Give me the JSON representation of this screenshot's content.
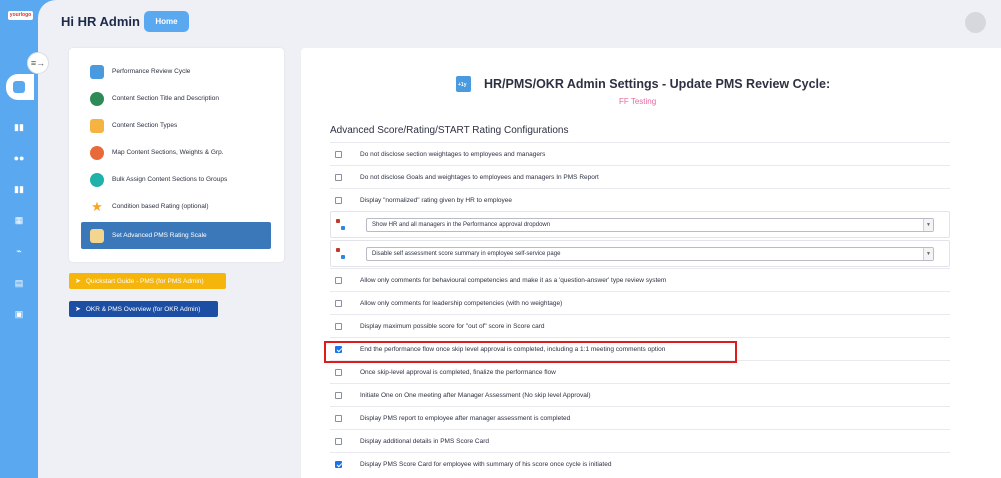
{
  "app": {
    "logo_text": "yourlogo",
    "greeting": "Hi HR Admin",
    "home_button": "Home"
  },
  "sidebar": {
    "icons": [
      "analytics-icon",
      "book-icon",
      "users-icon",
      "book-icon",
      "report-icon",
      "handshake-icon",
      "document-icon",
      "calendar-icon"
    ]
  },
  "left_menu": {
    "items": [
      {
        "label": "Performance Review Cycle",
        "icon": "calendar-icon",
        "color": "#4a9ae0"
      },
      {
        "label": "Content Section Title and Description",
        "icon": "sections-icon",
        "color": "#2e8b57"
      },
      {
        "label": "Content Section Types",
        "icon": "badge-icon",
        "color": "#f5b342"
      },
      {
        "label": "Map Content Sections, Weights & Grp.",
        "icon": "user-map-icon",
        "color": "#e86a3a"
      },
      {
        "label": "Bulk Assign Content Sections to Groups",
        "icon": "group-icon",
        "color": "#20b2aa"
      },
      {
        "label": "Condition based Rating (optional)",
        "icon": "star-icon",
        "color": "#f5a623"
      },
      {
        "label": "Set Advanced PMS Rating Scale",
        "icon": "rating-scale-icon",
        "color": "#ffffff",
        "active": true
      }
    ]
  },
  "guides": {
    "quickstart": {
      "label": "Quickstart Guide - PMS (for PMS Admin)",
      "color": "#f5b50a"
    },
    "overview": {
      "label": "OKR & PMS Overview (for OKR Admin)",
      "color": "#1c4ea3"
    }
  },
  "content": {
    "title": "HR/PMS/OKR Admin Settings - Update PMS Review Cycle:",
    "subtitle": "FF Testing",
    "section_title": "Advanced Score/Rating/START Rating Configurations",
    "options": [
      {
        "label": "Do not disclose section weightages to employees and managers",
        "checked": false
      },
      {
        "label": "Do not disclose Goals and weightages to employees and managers In PMS Report",
        "checked": false
      },
      {
        "label": "Display \"normalized\" rating given by HR to employee",
        "checked": false
      }
    ],
    "dropdowns": [
      {
        "value": "Show HR and all managers in the Performance approval dropdown"
      },
      {
        "value": "Disable self assessment score summary in employee self-service page"
      }
    ],
    "options2": [
      {
        "label": "Allow only comments for behavioural competencies and make it as a 'question-answer' type review system",
        "checked": false
      },
      {
        "label": "Allow only comments for leadership competencies (with no weightage)",
        "checked": false
      },
      {
        "label": "Display maximum possible score for \"out of\" score in Score card",
        "checked": false
      },
      {
        "label": "End the performance flow once skip level approval is completed, including a 1:1 meeting comments option",
        "checked": true
      },
      {
        "label": "Once skip-level approval is completed, finalize the performance flow",
        "checked": false
      },
      {
        "label": "Initiate One on One meeting after Manager Assessment (No skip level Approval)",
        "checked": false
      },
      {
        "label": "Display PMS report to employee after manager assessment is completed",
        "checked": false
      },
      {
        "label": "Display additional details in PMS Score Card",
        "checked": false
      },
      {
        "label": "Display PMS Score Card for employee with summary of his score once cycle is initiated",
        "checked": true
      }
    ]
  }
}
